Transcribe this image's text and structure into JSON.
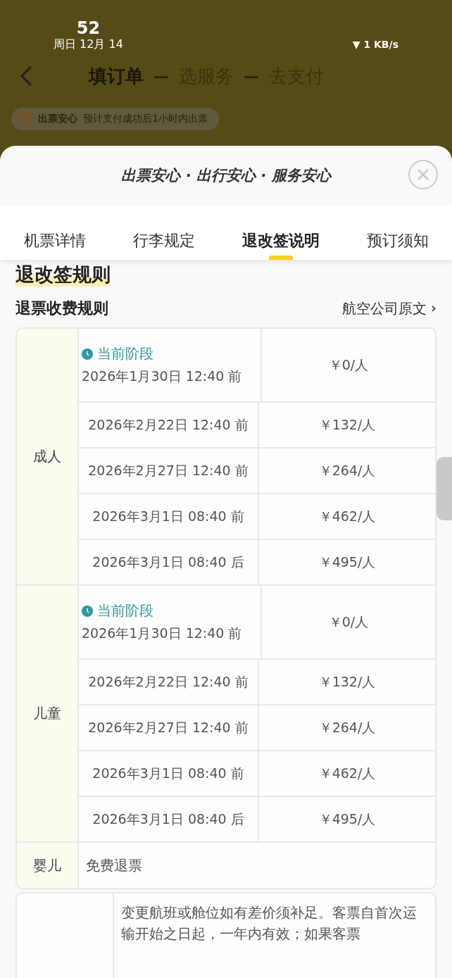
{
  "status_bar": {
    "time": "52",
    "date": "周日 12月 14",
    "network": "▼ 1 KB/s"
  },
  "steps": [
    {
      "label": "填订单",
      "selected": true
    },
    {
      "label": "选服务",
      "selected": false
    },
    {
      "label": "去支付",
      "selected": false
    }
  ],
  "step_separators": [
    "—",
    "—"
  ],
  "notice": {
    "title": "出票安心",
    "text": "预计支付成功后1小时内出票"
  },
  "sheet": {
    "title": "出票安心 · 出行安心 · 服务安心",
    "tabs": [
      {
        "label": "机票详情",
        "selected": false
      },
      {
        "label": "行李规定",
        "selected": false
      },
      {
        "label": "退改签说明",
        "selected": true
      },
      {
        "label": "预订须知",
        "selected": false
      }
    ]
  },
  "section_title": "退改签规则",
  "refund": {
    "title": "退票收费规则",
    "link": "航空公司原文",
    "link_arrow": "›",
    "groups": [
      {
        "kind": "tiered",
        "passenger": "成人",
        "rows": [
          {
            "current": true,
            "current_label": "当前阶段",
            "time": "2026年1月30日 12:40 前",
            "fee": "￥0/人"
          },
          {
            "current": false,
            "time": "2026年2月22日 12:40 前",
            "fee": "￥132/人"
          },
          {
            "current": false,
            "time": "2026年2月27日 12:40 前",
            "fee": "￥264/人"
          },
          {
            "current": false,
            "time": "2026年3月1日 08:40 前",
            "fee": "￥462/人"
          },
          {
            "current": false,
            "time": "2026年3月1日 08:40 后",
            "fee": "￥495/人"
          }
        ]
      },
      {
        "kind": "tiered",
        "passenger": "儿童",
        "rows": [
          {
            "current": true,
            "current_label": "当前阶段",
            "time": "2026年1月30日 12:40 前",
            "fee": "￥0/人"
          },
          {
            "current": false,
            "time": "2026年2月22日 12:40 前",
            "fee": "￥132/人"
          },
          {
            "current": false,
            "time": "2026年2月27日 12:40 前",
            "fee": "￥264/人"
          },
          {
            "current": false,
            "time": "2026年3月1日 08:40 前",
            "fee": "￥462/人"
          },
          {
            "current": false,
            "time": "2026年3月1日 08:40 后",
            "fee": "￥495/人"
          }
        ]
      },
      {
        "kind": "flat",
        "passenger": "婴儿",
        "note": "免费退票"
      }
    ]
  },
  "change_rules": {
    "text": "变更航班或舱位如有差价须补足。客票自首次运输开始之日起，一年内有效；如果客票"
  }
}
